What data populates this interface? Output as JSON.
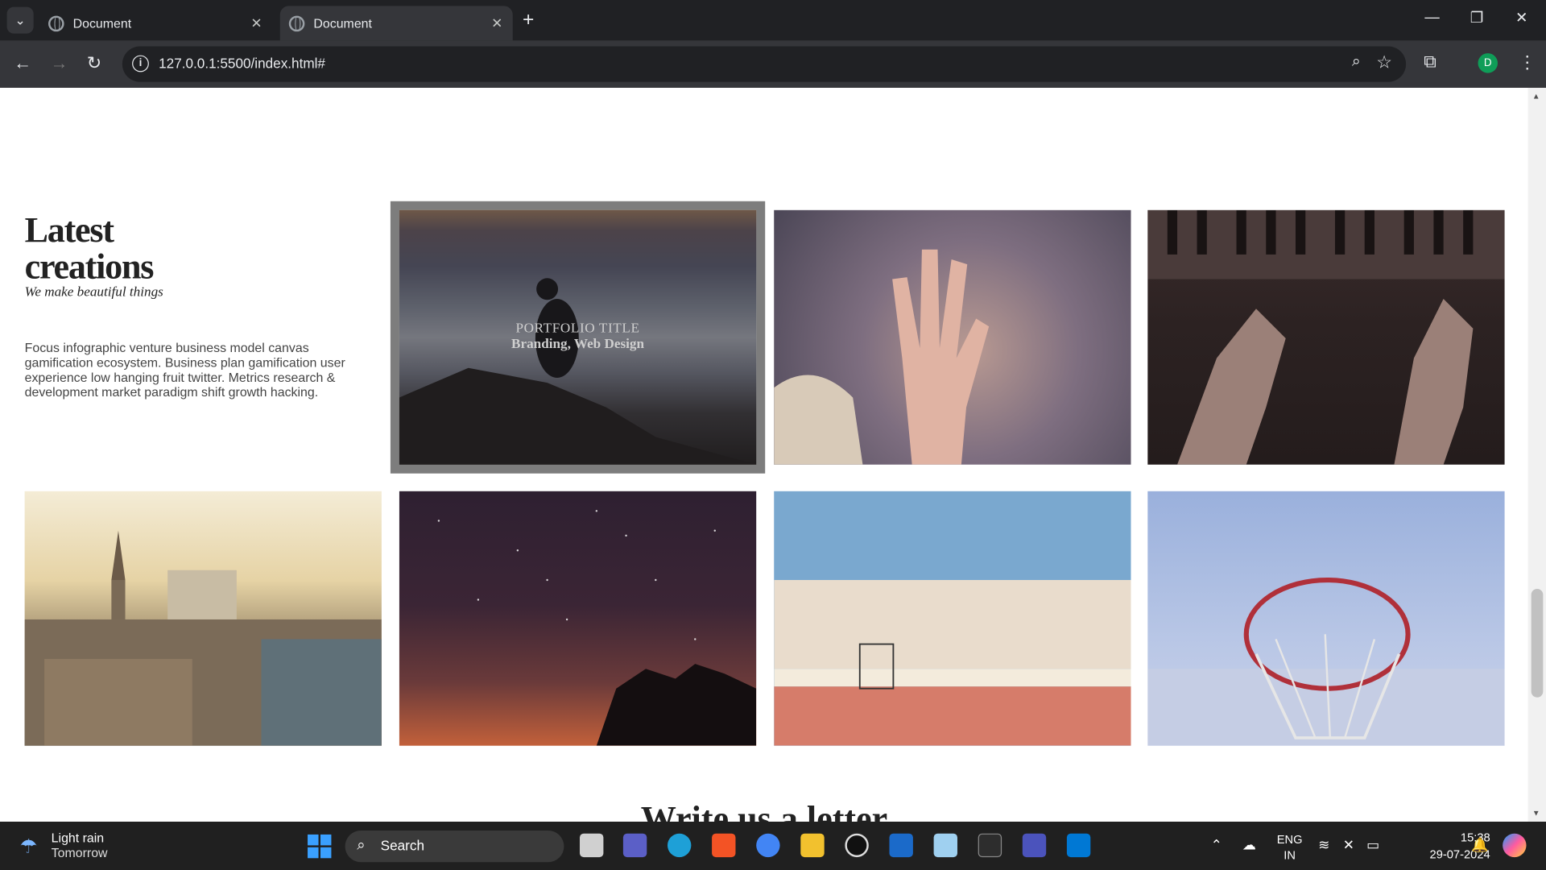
{
  "browser": {
    "tabs": [
      {
        "label": "Document"
      },
      {
        "label": "Document"
      }
    ],
    "url": "127.0.0.1:5500/index.html#",
    "profile_initial": "D"
  },
  "page": {
    "title": "Latest creations",
    "subtitle": "We make beautiful things",
    "description": "Focus infographic venture business model canvas gamification ecosystem. Business plan gamification user experience low hanging fruit twitter. Metrics research & development market paradigm shift growth hacking.",
    "portfolio": [
      {
        "overlay_title": "PORTFOLIO TITLE",
        "overlay_subtitle": "Branding, Web Design"
      }
    ],
    "next_heading": "Write us a letter"
  },
  "taskbar": {
    "weather_title": "Light rain",
    "weather_sub": "Tomorrow",
    "search_label": "Search",
    "lang_top": "ENG",
    "lang_bottom": "IN",
    "time": "15:38",
    "date": "29-07-2024"
  }
}
